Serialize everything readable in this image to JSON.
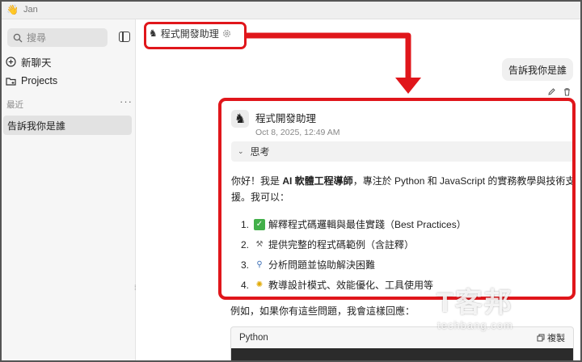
{
  "window": {
    "app_name": "Jan",
    "app_icon": "wave-hand-icon"
  },
  "sidebar": {
    "search_placeholder": "搜尋",
    "new_chat": "新聊天",
    "projects": "Projects",
    "recent_label": "最近",
    "more_icon": "···",
    "threads": [
      {
        "label": "告訴我你是誰"
      }
    ]
  },
  "main": {
    "assistant_name": "程式開發助理",
    "user_message": "告訴我你是誰",
    "reply": {
      "name": "程式開發助理",
      "timestamp": "Oct 8, 2025, 12:49 AM",
      "thinking_label": "思考",
      "intro_prefix": "你好！我是 ",
      "intro_bold": "AI 軟體工程導師",
      "intro_suffix": "，專注於 Python 和 JavaScript 的實務教學與技術支援。我可以：",
      "items": [
        {
          "num": "1.",
          "icon": "check-emoji",
          "text": "解釋程式碼邏輯與最佳實踐（Best Practices）"
        },
        {
          "num": "2.",
          "icon": "tools-emoji",
          "text": "提供完整的程式碼範例（含註釋）"
        },
        {
          "num": "3.",
          "icon": "magnifier-emoji",
          "text": "分析問題並協助解決困難"
        },
        {
          "num": "4.",
          "icon": "bulb-emoji",
          "text": "教導設計模式、效能優化、工具使用等"
        }
      ],
      "example_text": "例如，如果你有這些問題，我會這樣回應：",
      "code_language": "Python",
      "copy_label": "複製"
    }
  },
  "watermark": {
    "brand": "T客邦",
    "url": "techbang.com"
  },
  "colors": {
    "highlight": "#e0161b",
    "sidebar_bg": "#f6f6f6",
    "selected_thread": "#e2e2e2"
  }
}
